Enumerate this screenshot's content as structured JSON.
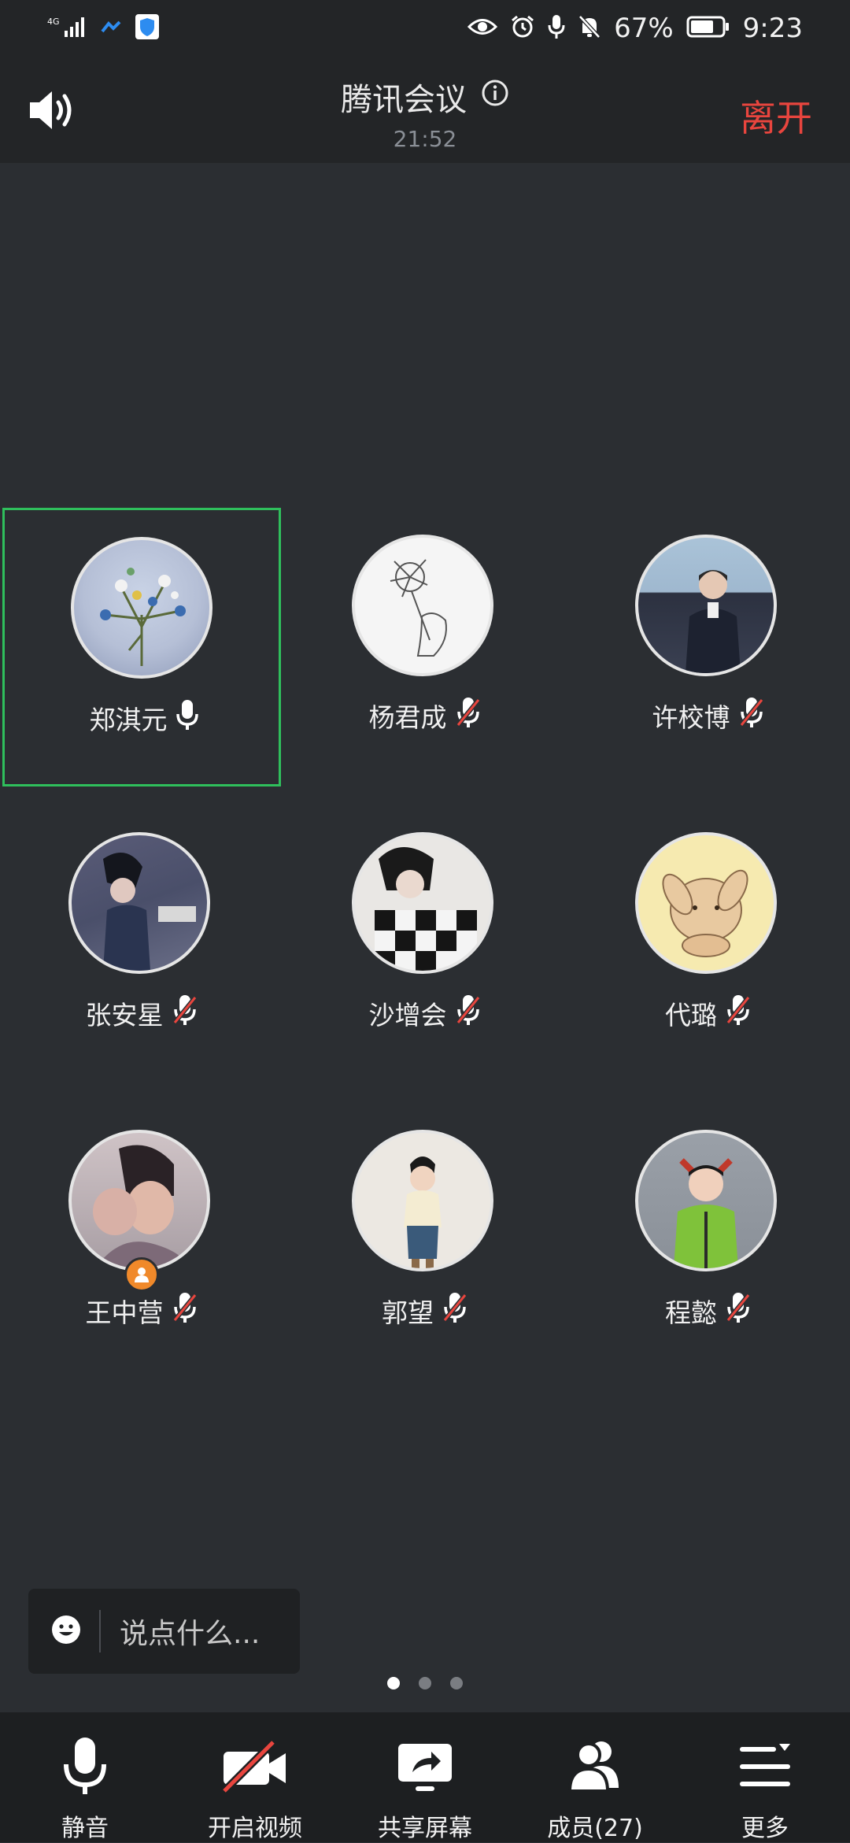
{
  "status_bar": {
    "network": "4G",
    "battery": "67%",
    "time": "9:23"
  },
  "header": {
    "title": "腾讯会议",
    "duration": "21:52",
    "leave_label": "离开"
  },
  "participants": [
    {
      "name": "郑淇元",
      "mic": "on",
      "active": true
    },
    {
      "name": "杨君成",
      "mic": "muted"
    },
    {
      "name": "许校博",
      "mic": "muted"
    },
    {
      "name": "张安星",
      "mic": "muted"
    },
    {
      "name": "沙增会",
      "mic": "muted"
    },
    {
      "name": "代璐",
      "mic": "muted"
    },
    {
      "name": "王中营",
      "mic": "muted",
      "host": true
    },
    {
      "name": "郭望",
      "mic": "muted"
    },
    {
      "name": "程懿",
      "mic": "muted"
    }
  ],
  "chat": {
    "placeholder": "说点什么..."
  },
  "pagination": {
    "pages": 3,
    "current": 1
  },
  "toolbar": {
    "mute_label": "静音",
    "video_label": "开启视频",
    "share_label": "共享屏幕",
    "members_label": "成员(27)",
    "more_label": "更多"
  },
  "colors": {
    "background": "#2b2e32",
    "bar": "#232527",
    "leave": "#e8453e",
    "active_border": "#2fbf5c",
    "muted_slash": "#e8453e"
  }
}
